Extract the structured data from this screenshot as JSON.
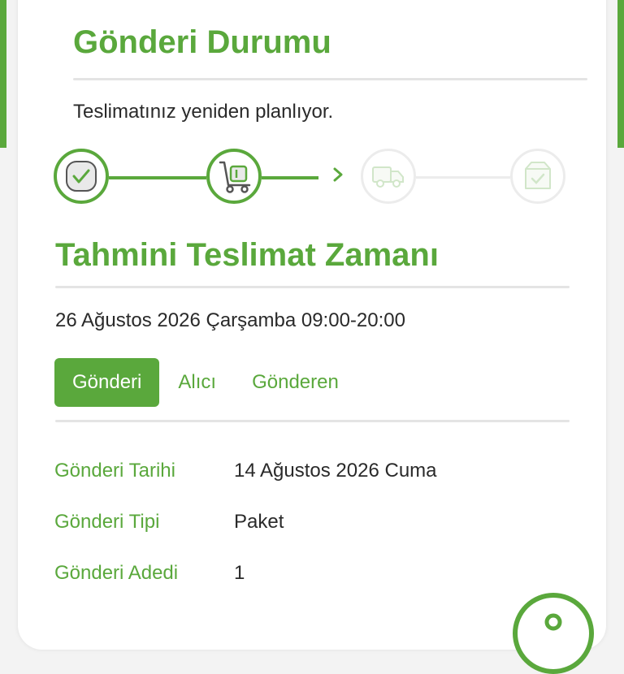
{
  "colors": {
    "accent": "#5aa83c",
    "pending": "#ececec",
    "text": "#2a2a2a"
  },
  "status": {
    "title": "Gönderi Durumu",
    "message": "Teslimatınız yeniden planlıyor.",
    "steps": [
      {
        "icon": "check-icon",
        "state": "done"
      },
      {
        "icon": "hand-truck-icon",
        "state": "done"
      },
      {
        "icon": "delivery-truck-icon",
        "state": "pending"
      },
      {
        "icon": "box-check-icon",
        "state": "pending"
      }
    ]
  },
  "estimate": {
    "title": "Tahmini Teslimat Zamanı",
    "value": "26 Ağustos 2026 Çarşamba 09:00-20:00"
  },
  "tabs": [
    {
      "label": "Gönderi",
      "active": true
    },
    {
      "label": "Alıcı",
      "active": false
    },
    {
      "label": "Gönderen",
      "active": false
    }
  ],
  "details": [
    {
      "label": "Gönderi Tarihi",
      "value": "14 Ağustos 2026 Cuma"
    },
    {
      "label": "Gönderi Tipi",
      "value": "Paket"
    },
    {
      "label": "Gönderi Adedi",
      "value": "1"
    }
  ]
}
